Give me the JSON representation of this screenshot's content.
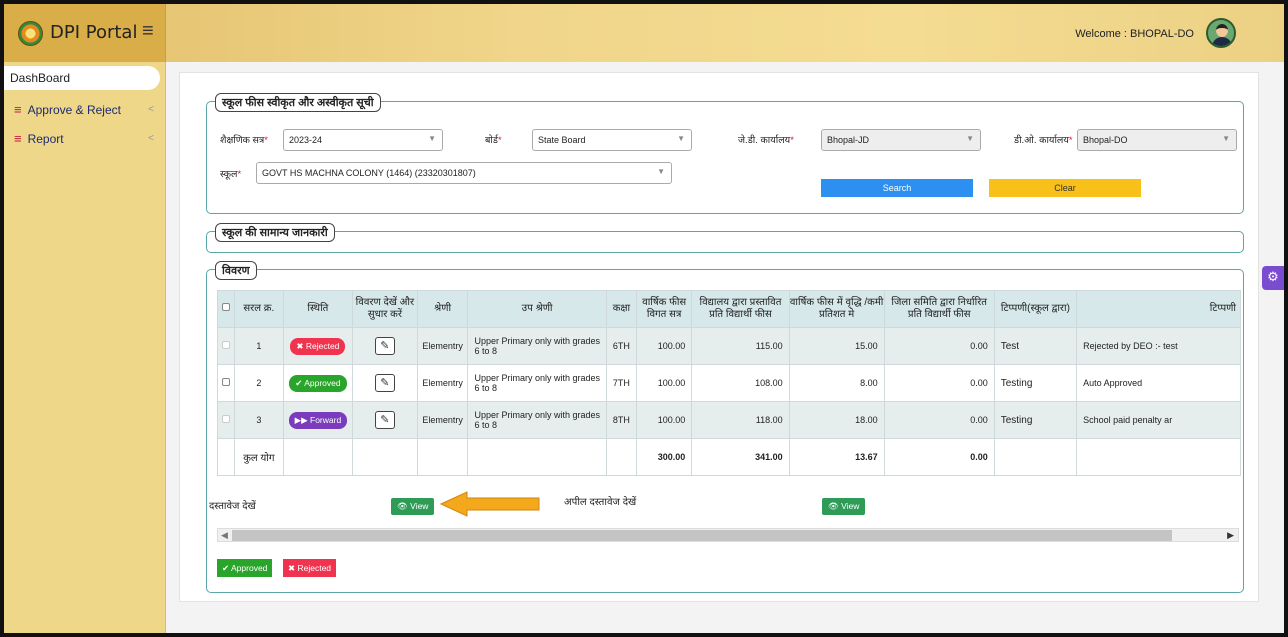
{
  "header": {
    "brand": "DPI Portal",
    "welcome": "Welcome : BHOPAL-DO"
  },
  "sidebar": {
    "items": [
      {
        "label": "DashBoard"
      },
      {
        "label": "Approve & Reject"
      },
      {
        "label": "Report"
      }
    ]
  },
  "filter": {
    "legend": "स्कूल फीस स्वीकृत और अस्वीकृत सूची",
    "session_label": "शैक्षणिक सत्र",
    "session_value": "2023-24",
    "board_label": "बोर्ड",
    "board_value": "State Board",
    "jd_label": "जे.डी. कार्यालय",
    "jd_value": "Bhopal-JD",
    "do_label": "डी.ओ. कार्यालय",
    "do_value": "Bhopal-DO",
    "school_label": "स्कूल",
    "school_value": "GOVT HS MACHNA COLONY (1464) (23320301807)",
    "search_label": "Search",
    "clear_label": "Clear",
    "required_mark": "*"
  },
  "general_info": {
    "legend": "स्कूल की सामान्य जानकारी"
  },
  "details": {
    "legend": "विवरण",
    "headers": [
      "",
      "सरल क्र.",
      "स्थिति",
      "विवरण देखें और सुधार करें",
      "श्रेणी",
      "उप श्रेणी",
      "कक्षा",
      "वार्षिक फीस विगत सत्र",
      "विद्यालय द्वारा प्रस्तावित प्रति विद्यार्थी फीस",
      "वार्षिक फीस में वृद्धि /कमी प्रतिशत मे",
      "जिला समिति द्वारा निर्धारित प्रति विद्यार्थी फीस",
      "टिप्पणी(स्कूल द्वारा)",
      "टिप्पणी"
    ],
    "rows": [
      {
        "sno": "1",
        "status": "Rejected",
        "category": "Elementry",
        "subcategory": "Upper Primary only with grades 6 to 8",
        "class": "6TH",
        "prev_fee": "100.00",
        "proposed_fee": "115.00",
        "change_pct": "15.00",
        "committee_fee": "0.00",
        "school_remark": "Test",
        "remark": "Rejected by DEO :- test"
      },
      {
        "sno": "2",
        "status": "Approved",
        "category": "Elementry",
        "subcategory": "Upper Primary only with grades 6 to 8",
        "class": "7TH",
        "prev_fee": "100.00",
        "proposed_fee": "108.00",
        "change_pct": "8.00",
        "committee_fee": "0.00",
        "school_remark": "Testing",
        "remark": "Auto Approved"
      },
      {
        "sno": "3",
        "status": "Forward",
        "category": "Elementry",
        "subcategory": "Upper Primary only with grades 6 to 8",
        "class": "8TH",
        "prev_fee": "100.00",
        "proposed_fee": "118.00",
        "change_pct": "18.00",
        "committee_fee": "0.00",
        "school_remark": "Testing",
        "remark": "School paid penalty ar"
      }
    ],
    "total": {
      "label": "कुल योग",
      "prev_fee": "300.00",
      "proposed_fee": "341.00",
      "change_pct": "13.67",
      "committee_fee": "0.00"
    },
    "doc_label": "दस्तावेज देखें",
    "appeal_doc_label": "अपील दस्तावेज देखें",
    "view_label": "View",
    "approve_label": "Approved",
    "reject_label": "Rejected"
  },
  "colors": {
    "rejected": "#f0344f",
    "approved": "#2aa52b",
    "forward": "#7a3bbd",
    "search": "#2d8ff0",
    "clear": "#f8c11a"
  }
}
